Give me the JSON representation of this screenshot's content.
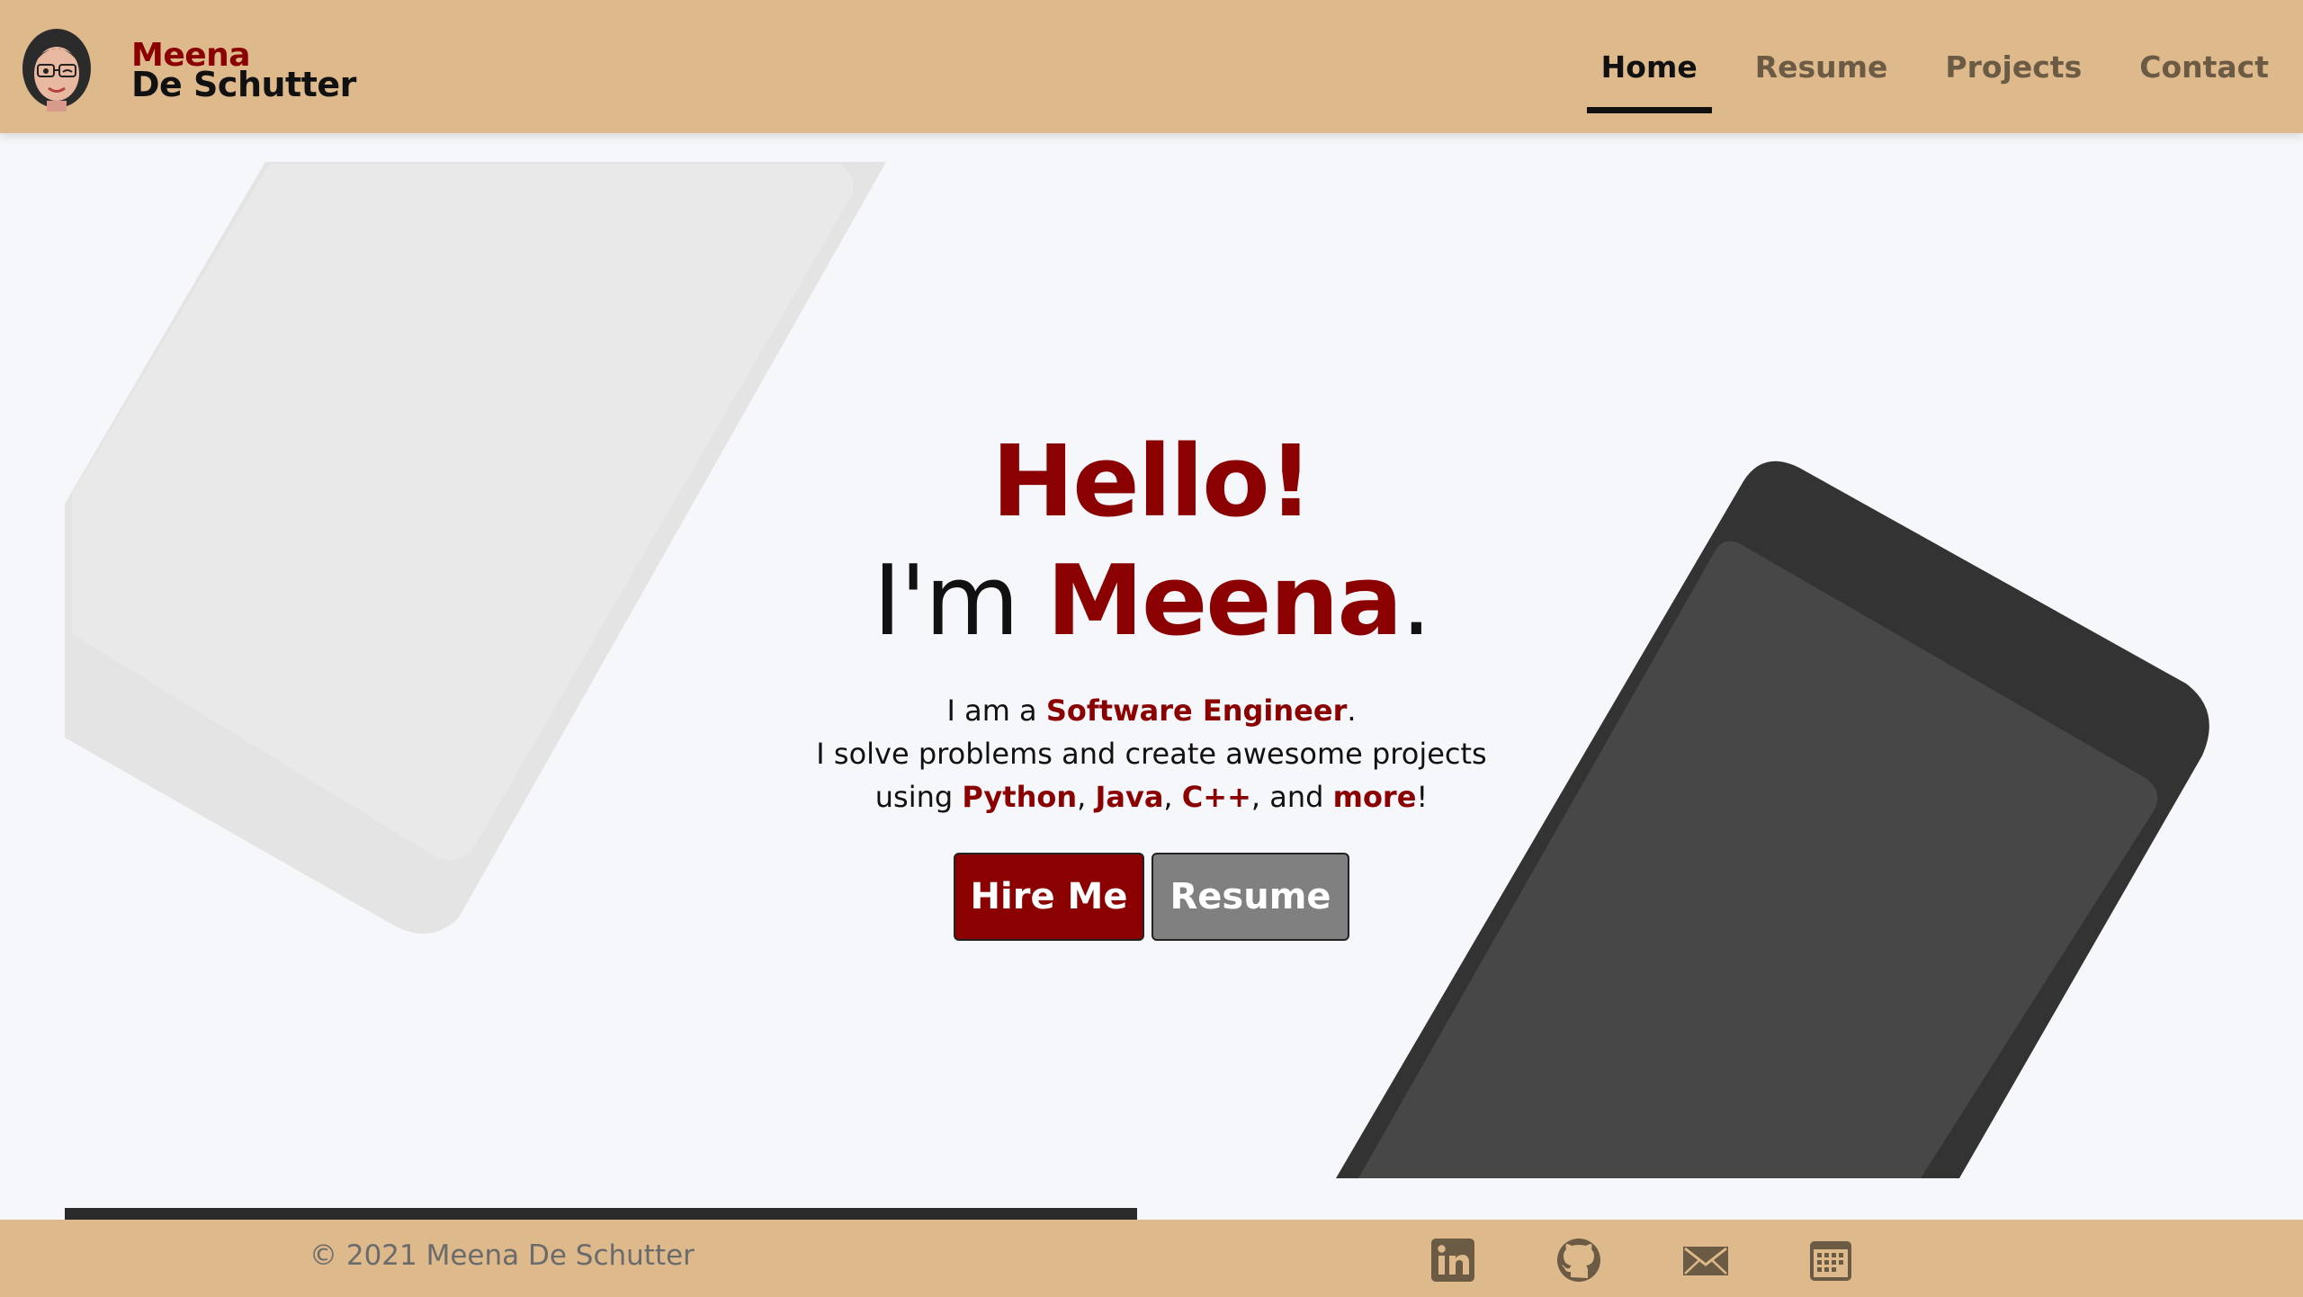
{
  "header": {
    "brand_first": "Meena",
    "brand_last": "De Schutter",
    "nav": [
      {
        "label": "Home",
        "active": true
      },
      {
        "label": "Resume",
        "active": false
      },
      {
        "label": "Projects",
        "active": false
      },
      {
        "label": "Contact",
        "active": false
      }
    ]
  },
  "hero": {
    "greeting": "Hello!",
    "intro_prefix": "I'm ",
    "intro_name": "Meena",
    "intro_suffix": ".",
    "line1_prefix": "I am a ",
    "role": "Software Engineer",
    "line1_suffix": ".",
    "line2": "I solve problems and create awesome projects",
    "line3_prefix": "using ",
    "lang1": "Python",
    "sep1": ", ",
    "lang2": "Java",
    "sep2": ", ",
    "lang3": "C++",
    "sep3": ", and ",
    "more": "more",
    "line3_suffix": "!",
    "hire_button": "Hire Me",
    "resume_button": "Resume"
  },
  "footer": {
    "copyright": "© 2021 Meena De Schutter",
    "icons": [
      "linkedin-icon",
      "github-icon",
      "email-icon",
      "calendar-icon"
    ]
  },
  "colors": {
    "accent": "#8b0000",
    "header_bg": "#deb98c",
    "page_bg": "#f6f7fa",
    "nav_inactive": "#6b5a44"
  }
}
